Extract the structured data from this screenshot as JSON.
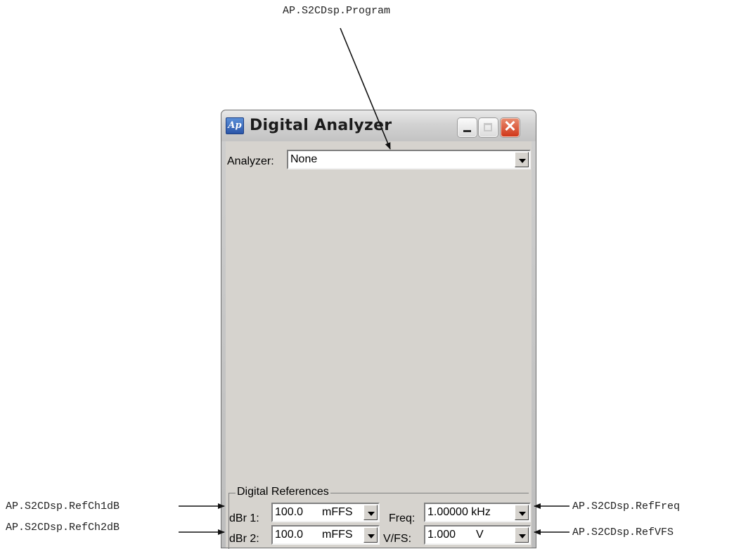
{
  "annotations": {
    "program": "AP.S2CDsp.Program",
    "ref_ch1": "AP.S2CDsp.RefCh1dB",
    "ref_ch2": "AP.S2CDsp.RefCh2dB",
    "ref_freq": "AP.S2CDsp.RefFreq",
    "ref_vfs": "AP.S2CDsp.RefVFS"
  },
  "window": {
    "icon_text": "Ap",
    "title": "Digital Analyzer",
    "close_glyph": "✕"
  },
  "analyzer": {
    "label": "Analyzer:",
    "value": "None"
  },
  "digital_references": {
    "group_label": "Digital References",
    "dbr1": {
      "label": "dBr 1:",
      "value": "100.0",
      "unit": "mFFS"
    },
    "dbr2": {
      "label": "dBr 2:",
      "value": "100.0",
      "unit": "mFFS"
    },
    "freq": {
      "label": "Freq:",
      "value": "1.00000 kHz"
    },
    "vfs": {
      "label": "V/FS:",
      "value": "1.000",
      "unit": "V"
    }
  }
}
